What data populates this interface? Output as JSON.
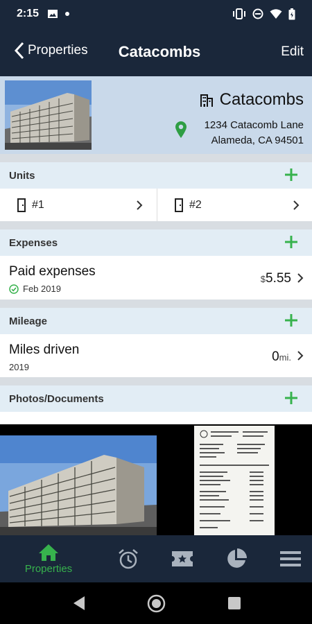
{
  "status": {
    "time": "2:15"
  },
  "app_bar": {
    "back_label": "Properties",
    "title": "Catacombs",
    "edit_label": "Edit"
  },
  "property": {
    "name": "Catacombs",
    "address_line1": "1234 Catacomb Lane",
    "address_line2": "Alameda, CA 94501"
  },
  "sections": {
    "units": {
      "title": "Units",
      "items": [
        {
          "label": "#1"
        },
        {
          "label": "#2"
        }
      ]
    },
    "expenses": {
      "title": "Expenses",
      "item_title": "Paid expenses",
      "period": "Feb 2019",
      "currency_symbol": "$",
      "amount": "5.55"
    },
    "mileage": {
      "title": "Mileage",
      "item_title": "Miles driven",
      "period": "2019",
      "value": "0",
      "unit": "mi."
    },
    "photos": {
      "title": "Photos/Documents"
    }
  },
  "tabs": [
    {
      "label": "Properties",
      "icon": "home-icon",
      "active": true
    },
    {
      "icon": "alarm-icon"
    },
    {
      "icon": "ticket-icon"
    },
    {
      "icon": "pie-chart-icon"
    },
    {
      "icon": "menu-icon"
    }
  ],
  "colors": {
    "primary_dark": "#1a273a",
    "accent_green": "#37b24d",
    "header_blue": "#c9d9ea",
    "section_bg": "#e2edf5"
  }
}
